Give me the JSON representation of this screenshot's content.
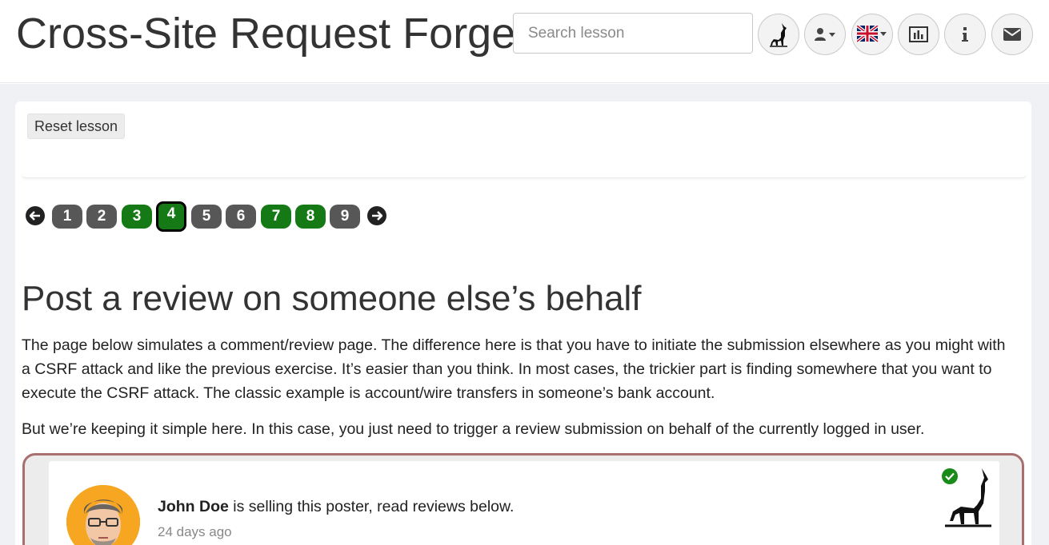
{
  "header": {
    "title": "Cross-Site Request Forgeries",
    "search_placeholder": "Search lesson",
    "icons": [
      "wolf-icon",
      "user-menu-icon",
      "language-flag-icon",
      "report-card-icon",
      "about-icon",
      "contact-icon"
    ]
  },
  "lesson": {
    "reset_label": "Reset lesson",
    "pages": [
      {
        "label": "1",
        "status": "incomplete"
      },
      {
        "label": "2",
        "status": "incomplete"
      },
      {
        "label": "3",
        "status": "complete"
      },
      {
        "label": "4",
        "status": "current"
      },
      {
        "label": "5",
        "status": "incomplete"
      },
      {
        "label": "6",
        "status": "incomplete"
      },
      {
        "label": "7",
        "status": "complete"
      },
      {
        "label": "8",
        "status": "complete"
      },
      {
        "label": "9",
        "status": "incomplete"
      }
    ],
    "heading": "Post a review on someone else’s behalf",
    "paragraph1": "The page below simulates a comment/review page. The difference here is that you have to initiate the submission elsewhere as you might with a CSRF attack and like the previous exercise. It’s easier than you think. In most cases, the trickier part is finding somewhere that you want to execute the CSRF attack. The classic example is account/wire transfers in someone’s bank account.",
    "paragraph2": "But we’re keeping it simple here. In this case, you just need to trigger a review submission on behalf of the currently logged in user."
  },
  "review": {
    "seller": "John Doe",
    "text": " is selling this poster, read reviews below.",
    "time": "24 days ago"
  },
  "colors": {
    "complete": "#157a15",
    "incomplete": "#575757",
    "frame_border": "#a96f6f"
  }
}
